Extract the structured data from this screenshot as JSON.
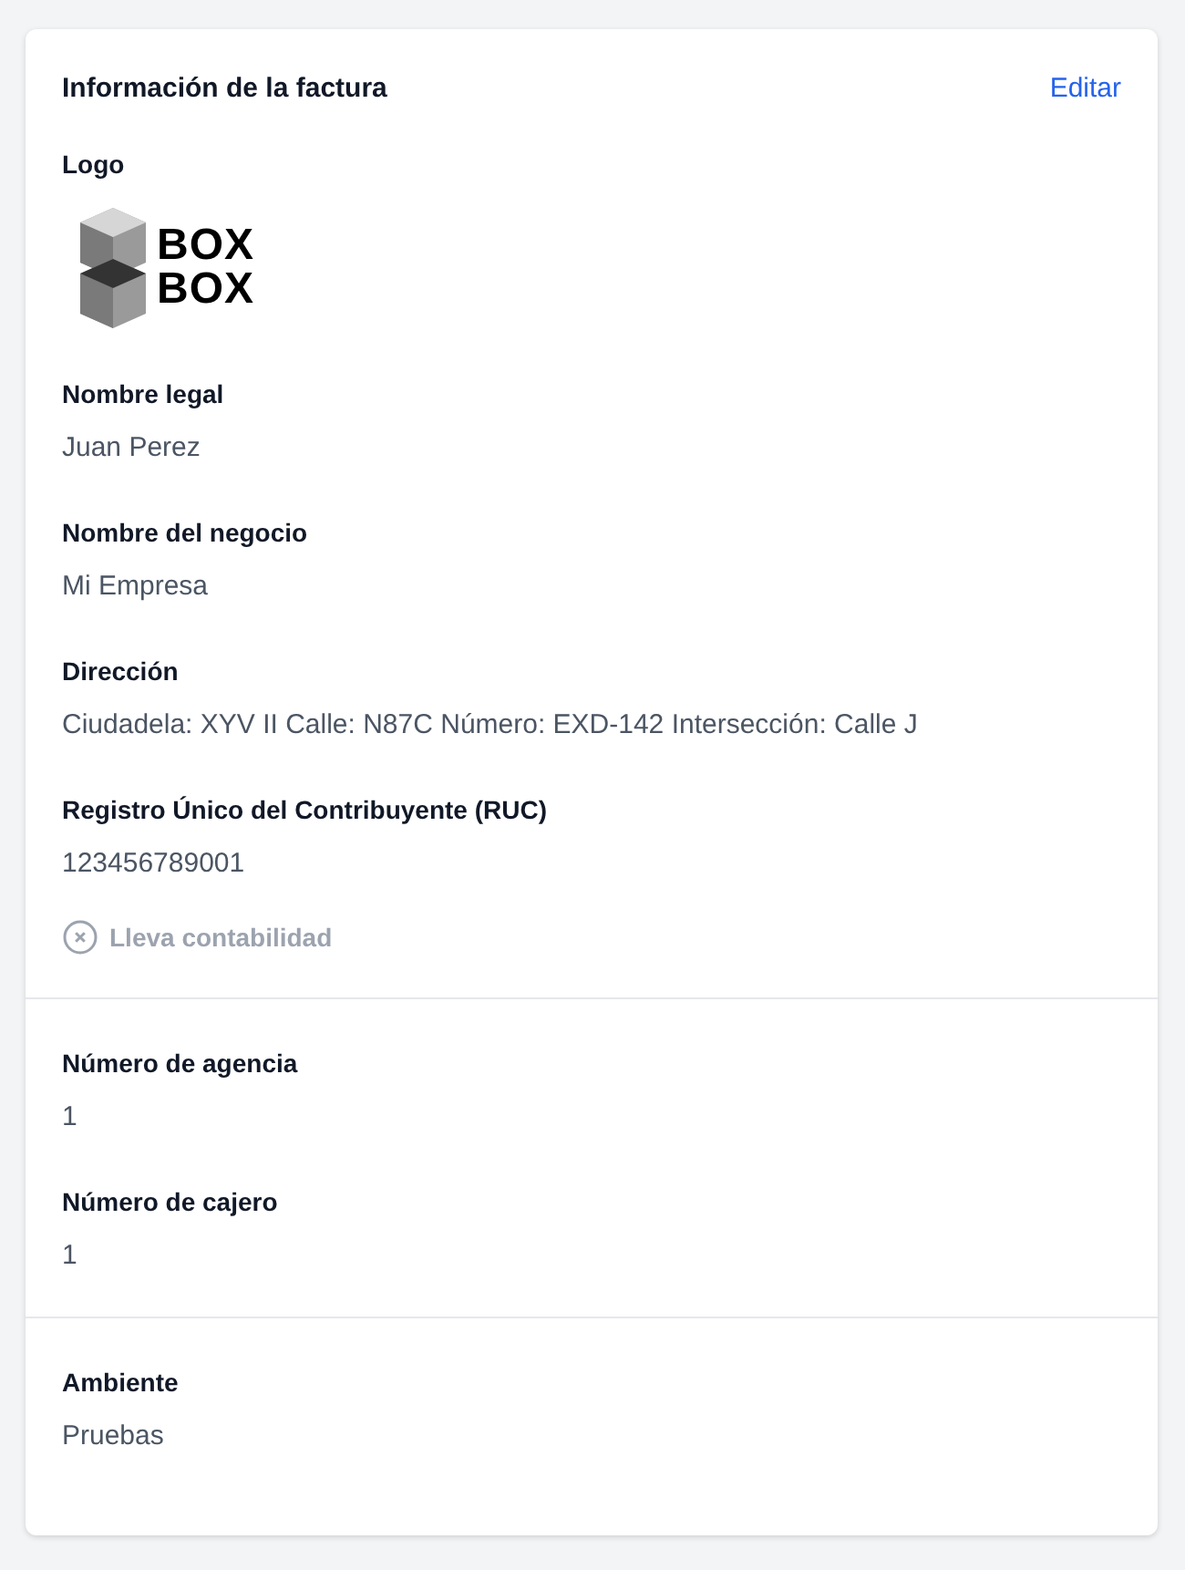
{
  "card": {
    "title": "Información de la factura",
    "edit_link": "Editar"
  },
  "sections": [
    {
      "fields": [
        {
          "kind": "logo",
          "label": "Logo",
          "logo_text": [
            "BOX",
            "BOX"
          ]
        },
        {
          "kind": "text",
          "label": "Nombre legal",
          "value": "Juan Perez"
        },
        {
          "kind": "text",
          "label": "Nombre del negocio",
          "value": "Mi Empresa"
        },
        {
          "kind": "text",
          "label": "Dirección",
          "value": "Ciudadela: XYV II Calle: N87C Número: EXD-142 Intersección: Calle J"
        },
        {
          "kind": "text",
          "label": "Registro Único del Contribuyente (RUC)",
          "value": "123456789001"
        },
        {
          "kind": "flag",
          "label": "Lleva contabilidad",
          "checked": false
        }
      ]
    },
    {
      "fields": [
        {
          "kind": "text",
          "label": "Número de agencia",
          "value": "1"
        },
        {
          "kind": "text",
          "label": "Número de cajero",
          "value": "1"
        }
      ]
    },
    {
      "fields": [
        {
          "kind": "text",
          "label": "Ambiente",
          "value": "Pruebas"
        }
      ]
    }
  ]
}
